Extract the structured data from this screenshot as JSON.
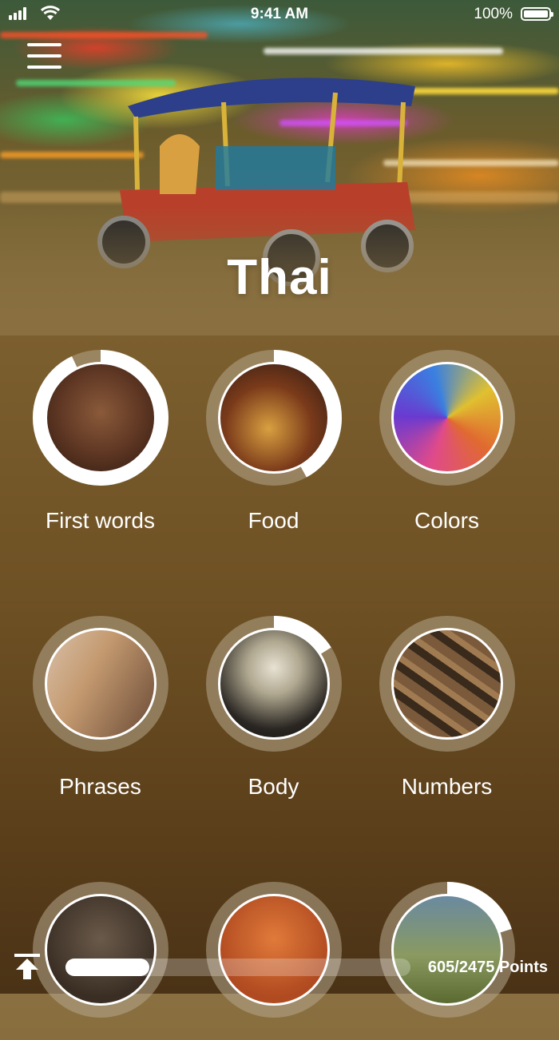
{
  "status_bar": {
    "time": "9:41 AM",
    "battery_percent": "100%"
  },
  "header": {
    "menu_icon": "hamburger-menu-icon",
    "title": "Thai"
  },
  "categories": [
    {
      "label": "First words",
      "progress": 0.93,
      "photo": "baby-face"
    },
    {
      "label": "Food",
      "progress": 0.42,
      "photo": "burger-and-cola"
    },
    {
      "label": "Colors",
      "progress": 0.0,
      "photo": "colored-powder"
    },
    {
      "label": "Phrases",
      "progress": 0.0,
      "photo": "smiling-couple"
    },
    {
      "label": "Body",
      "progress": 0.16,
      "photo": "skeleton"
    },
    {
      "label": "Numbers",
      "progress": 0.0,
      "photo": "wooden-number-blocks"
    },
    {
      "label": "",
      "progress": 0.0,
      "photo": "headphones"
    },
    {
      "label": "",
      "progress": 0.0,
      "photo": "orange-flowers"
    },
    {
      "label": "",
      "progress": 0.2,
      "photo": "landscape"
    }
  ],
  "footer": {
    "upload_icon": "scroll-to-top-icon",
    "progress": 0.244,
    "points_text": "605/2475 Points"
  },
  "colors": {
    "ring_track": "#b5a68c",
    "ring_fill": "#ffffff"
  }
}
